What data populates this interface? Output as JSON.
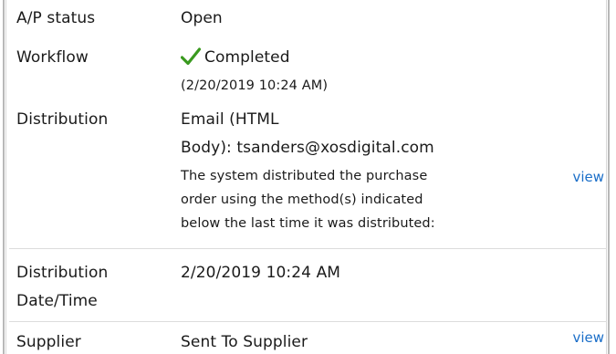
{
  "rows": {
    "ap_status": {
      "label": "A/P status",
      "value": "Open"
    },
    "workflow": {
      "label": "Workflow",
      "value": "Completed",
      "timestamp": "(2/20/2019 10:24 AM)",
      "icon": "checkmark-icon",
      "icon_color": "#3a9a1f"
    },
    "distribution": {
      "label": "Distribution",
      "value_line1": "Email (HTML",
      "value_line2": "Body): tsanders@xosdigital.com",
      "note_line1": "The system distributed the purchase",
      "note_line2": "order using the method(s) indicated",
      "note_line3": "below the last time it was distributed:",
      "link": "view"
    },
    "distribution_datetime": {
      "label_line1": "Distribution",
      "label_line2": "Date/Time",
      "value": "2/20/2019 10:24 AM"
    },
    "supplier": {
      "label": "Supplier",
      "value": "Sent To Supplier",
      "link": "view"
    }
  },
  "colors": {
    "link": "#1a6ec8",
    "text": "#1a1a1a",
    "border": "#b8b8b8"
  }
}
